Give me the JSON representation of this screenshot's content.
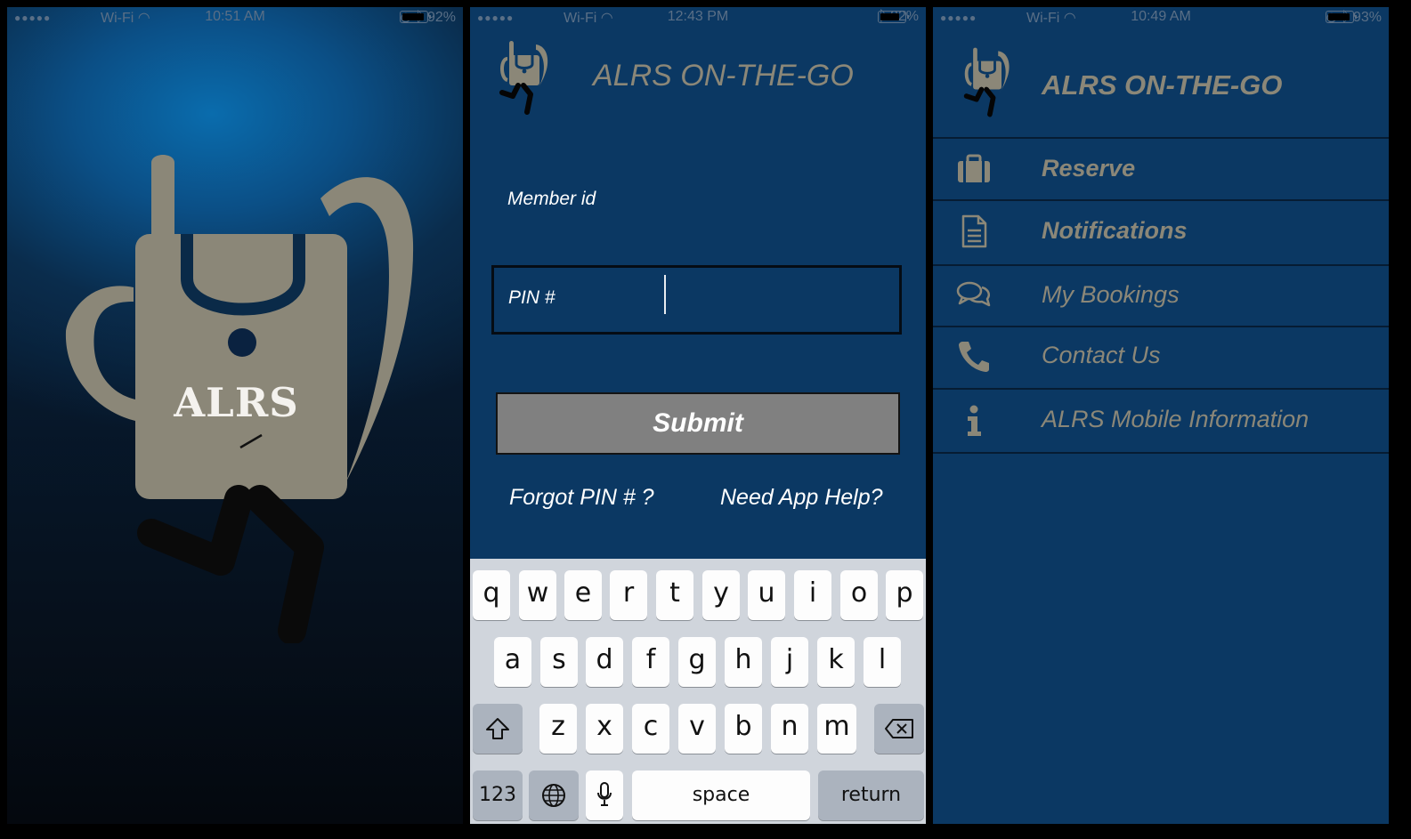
{
  "screen1": {
    "status": {
      "signal": "●●●●●",
      "carrier": "Wi-Fi",
      "time": "10:51 AM",
      "battery_percent": "92%",
      "battery_level": 0.92
    },
    "logo_text": "ALRS"
  },
  "screen2": {
    "status": {
      "signal": "●●●●●",
      "carrier": "Wi-Fi",
      "time": "12:43 PM",
      "battery_percent": "82%",
      "battery_level": 0.82
    },
    "app_title": "ALRS ON-THE-GO",
    "member_label": "Member id",
    "pin_label": "PIN #",
    "pin_value": "",
    "submit_label": "Submit",
    "forgot_link": "Forgot PIN # ?",
    "help_link": "Need App Help?",
    "keyboard": {
      "row1": [
        "q",
        "w",
        "e",
        "r",
        "t",
        "y",
        "u",
        "i",
        "o",
        "p"
      ],
      "row2": [
        "a",
        "s",
        "d",
        "f",
        "g",
        "h",
        "j",
        "k",
        "l"
      ],
      "row3": [
        "z",
        "x",
        "c",
        "v",
        "b",
        "n",
        "m"
      ],
      "numbers_key": "123",
      "space_key": "space",
      "return_key": "return"
    }
  },
  "screen3": {
    "status": {
      "signal": "●●●●●",
      "carrier": "Wi-Fi",
      "time": "10:49 AM",
      "battery_percent": "93%",
      "battery_level": 0.93
    },
    "app_title": "ALRS ON-THE-GO",
    "menu": [
      {
        "label": "Reserve",
        "icon": "briefcase-icon",
        "bold": true
      },
      {
        "label": "Notifications",
        "icon": "document-icon",
        "bold": true
      },
      {
        "label": "My Bookings",
        "icon": "chat-bubbles-icon",
        "bold": false
      },
      {
        "label": "Contact Us",
        "icon": "phone-icon",
        "bold": false
      },
      {
        "label": "ALRS Mobile Information",
        "icon": "info-icon",
        "bold": false
      }
    ]
  },
  "colors": {
    "screen_bg": "#0b3863",
    "logo_gray": "#8b8778",
    "submit_gray": "#808080",
    "keyboard_bg": "#d0d5dc"
  }
}
